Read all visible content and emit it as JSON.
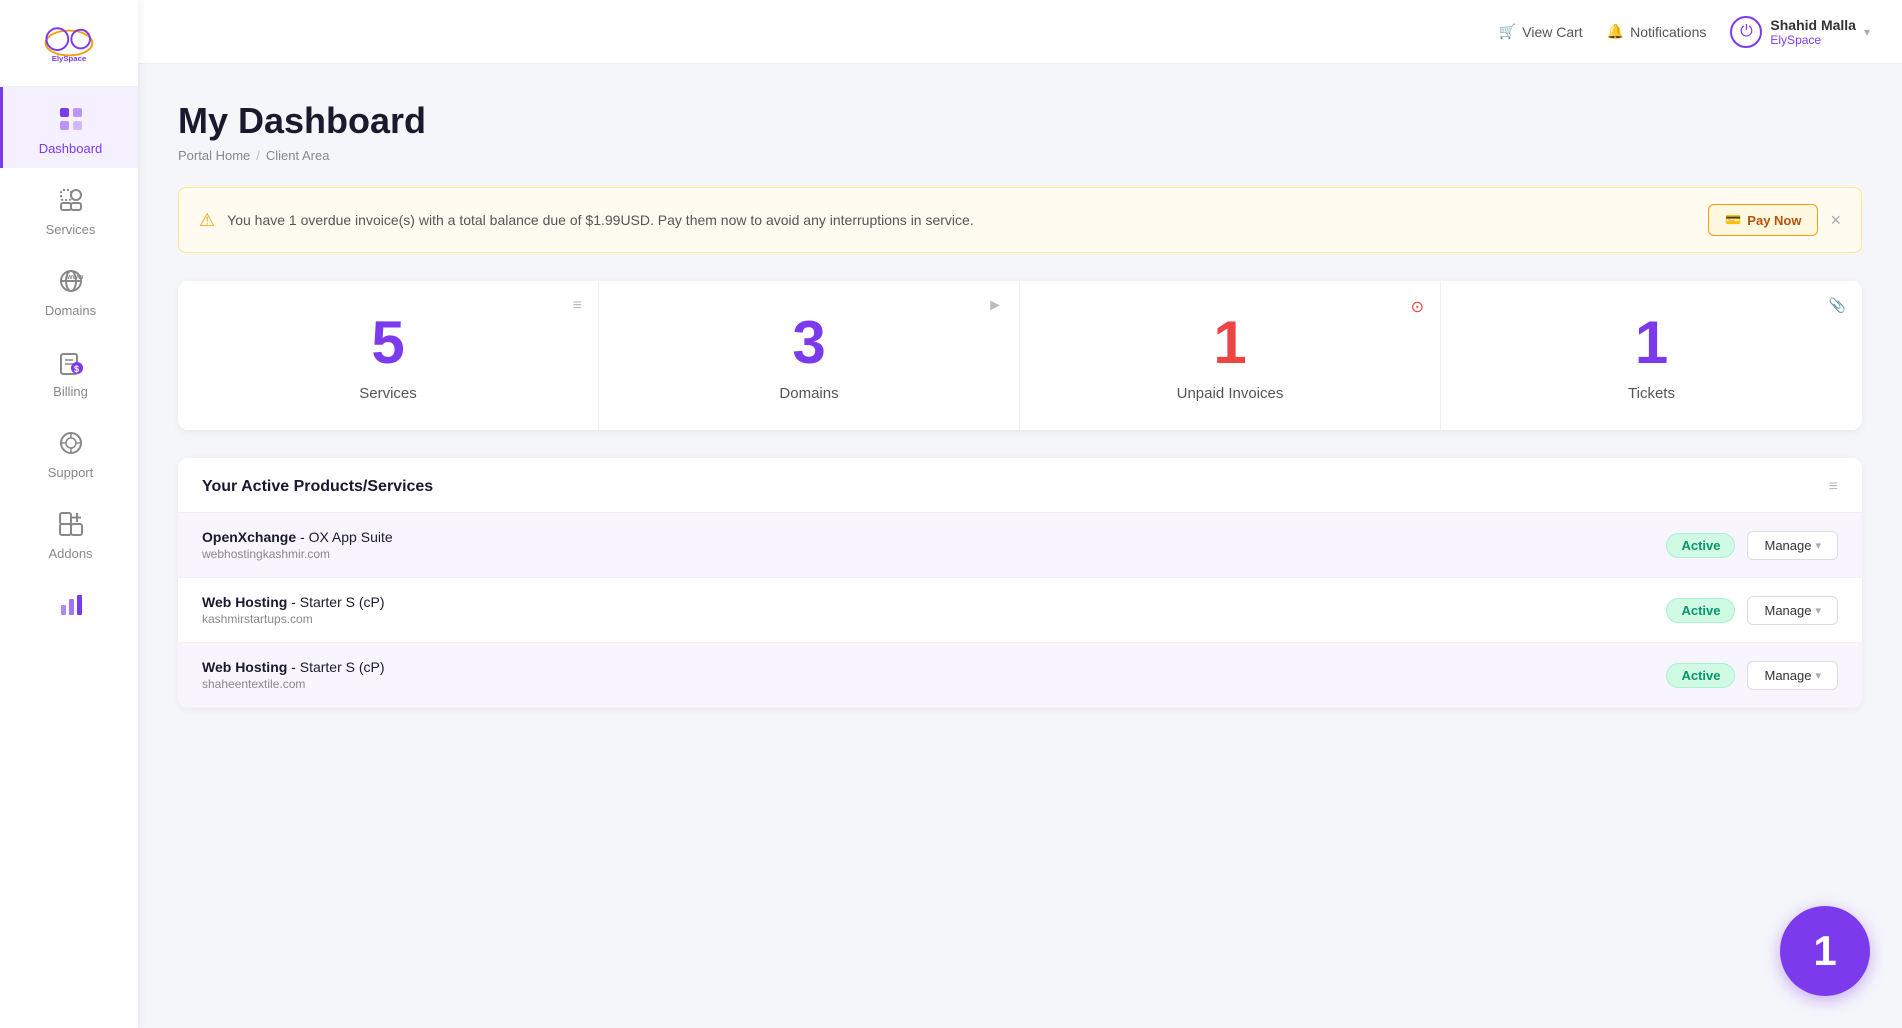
{
  "brand": {
    "name": "ElySpace"
  },
  "topbar": {
    "cart_label": "View Cart",
    "notifications_label": "Notifications",
    "user_name": "Shahid Malla",
    "user_sub": "ElySpace",
    "chevron": "▾"
  },
  "sidebar": {
    "items": [
      {
        "id": "dashboard",
        "label": "Dashboard",
        "active": true
      },
      {
        "id": "services",
        "label": "Services",
        "active": false
      },
      {
        "id": "domains",
        "label": "Domains",
        "active": false
      },
      {
        "id": "billing",
        "label": "Billing",
        "active": false
      },
      {
        "id": "support",
        "label": "Support",
        "active": false
      },
      {
        "id": "addons",
        "label": "Addons",
        "active": false
      },
      {
        "id": "reports",
        "label": "",
        "active": false
      }
    ]
  },
  "page": {
    "title": "My Dashboard",
    "breadcrumb_home": "Portal Home",
    "breadcrumb_sep": "/",
    "breadcrumb_current": "Client Area"
  },
  "alert": {
    "text": "You have 1 overdue invoice(s) with a total balance due of $1.99USD. Pay them now to avoid any interruptions in service.",
    "pay_now_label": "Pay Now",
    "close_label": "×"
  },
  "stats": [
    {
      "number": "5",
      "label": "Services",
      "color": "purple",
      "icon": "≡"
    },
    {
      "number": "3",
      "label": "Domains",
      "color": "purple",
      "icon": "►"
    },
    {
      "number": "1",
      "label": "Unpaid Invoices",
      "color": "red",
      "icon": "⊙"
    },
    {
      "number": "1",
      "label": "Tickets",
      "color": "purple",
      "icon": "📎"
    }
  ],
  "products_section": {
    "title": "Your Active Products/Services",
    "icon": "≡",
    "rows": [
      {
        "name": "OpenXchange",
        "plan": "OX App Suite",
        "domain": "webhostingkashmir.com",
        "status": "Active",
        "manage_label": "Manage"
      },
      {
        "name": "Web Hosting",
        "plan": "Starter S (cP)",
        "domain": "kashmirstartups.com",
        "status": "Active",
        "manage_label": "Manage"
      },
      {
        "name": "Web Hosting",
        "plan": "Starter S (cP)",
        "domain": "shaheentextile.com",
        "status": "Active",
        "manage_label": "Manage"
      }
    ]
  },
  "notification_circle": {
    "number": "1"
  }
}
